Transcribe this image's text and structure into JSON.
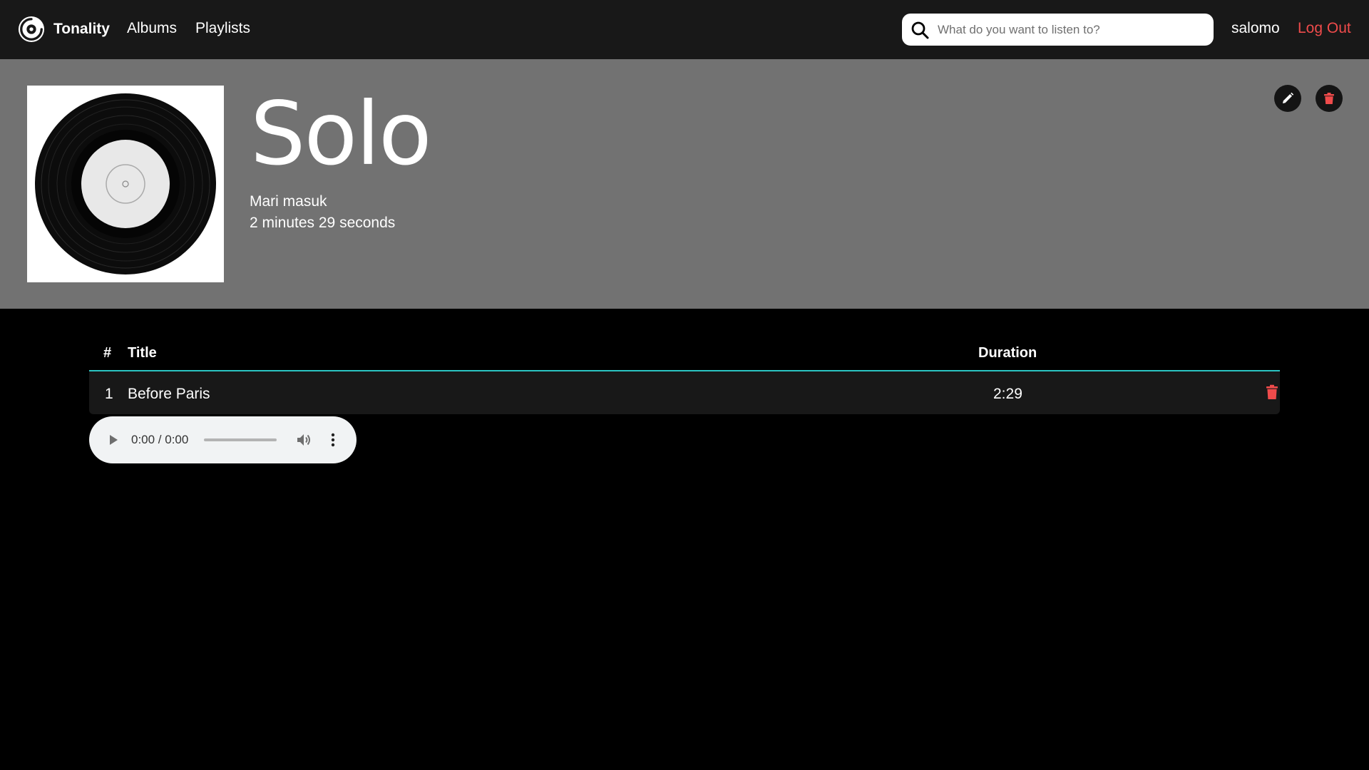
{
  "navbar": {
    "brand": "Tonality",
    "links": [
      "Albums",
      "Playlists"
    ],
    "search": {
      "placeholder": "What do you want to listen to?",
      "value": ""
    },
    "username": "salomo",
    "logout": "Log Out"
  },
  "album": {
    "title": "Solo",
    "artist": "Mari masuk",
    "duration": "2 minutes 29 seconds",
    "header_bg": "#727272"
  },
  "table": {
    "headers": {
      "number": "#",
      "title": "Title",
      "duration": "Duration"
    },
    "rows": [
      {
        "number": "1",
        "title": "Before Paris",
        "duration": "2:29"
      }
    ]
  },
  "player": {
    "time": "0:00 / 0:00",
    "progress": 0
  },
  "colors": {
    "accent": "#2bc4c2",
    "danger": "#ef4b4b",
    "navbar_bg": "#181818",
    "row_bg": "#181818"
  },
  "icons": [
    "logo-icon",
    "search-icon",
    "edit-icon",
    "trash-icon",
    "play-icon",
    "volume-icon",
    "more-vertical-icon",
    "vinyl-record-icon"
  ]
}
